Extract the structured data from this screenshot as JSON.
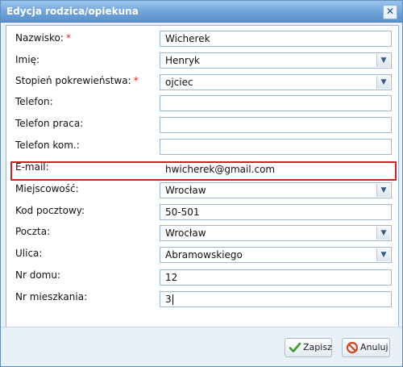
{
  "dialog": {
    "title": "Edycja rodzica/opiekuna",
    "close_glyph": "✕"
  },
  "form": {
    "nazwisko": {
      "label": "Nazwisko:",
      "value": "Wicherek",
      "required": "*"
    },
    "imie": {
      "label": "Imię:",
      "value": "Henryk"
    },
    "stopien": {
      "label": "Stopień pokrewieństwa:",
      "value": "ojciec",
      "required": "*"
    },
    "telefon": {
      "label": "Telefon:",
      "value": ""
    },
    "telefon_praca": {
      "label": "Telefon praca:",
      "value": ""
    },
    "telefon_kom": {
      "label": "Telefon kom.:",
      "value": ""
    },
    "email": {
      "label": "E-mail:",
      "value": "hwicherek@gmail.com"
    },
    "miejscowosc": {
      "label": "Miejscowość:",
      "value": "Wrocław"
    },
    "kod": {
      "label": "Kod pocztowy:",
      "value": "50-501"
    },
    "poczta": {
      "label": "Poczta:",
      "value": "Wrocław"
    },
    "ulica": {
      "label": "Ulica:",
      "value": "Abramowskiego"
    },
    "nr_domu": {
      "label": "Nr domu:",
      "value": "12"
    },
    "nr_mieszkania": {
      "label": "Nr mieszkania:",
      "value": "3"
    }
  },
  "footer": {
    "save_label": "Zapisz",
    "cancel_label": "Anuluj"
  },
  "icons": {
    "dropdown": "chevron-down-icon",
    "save": "checkmark-icon",
    "cancel": "cancel-icon"
  },
  "colors": {
    "title_bar": "#6fa3d8",
    "highlight": "#d21f1f",
    "required_mark": "#e02020"
  }
}
